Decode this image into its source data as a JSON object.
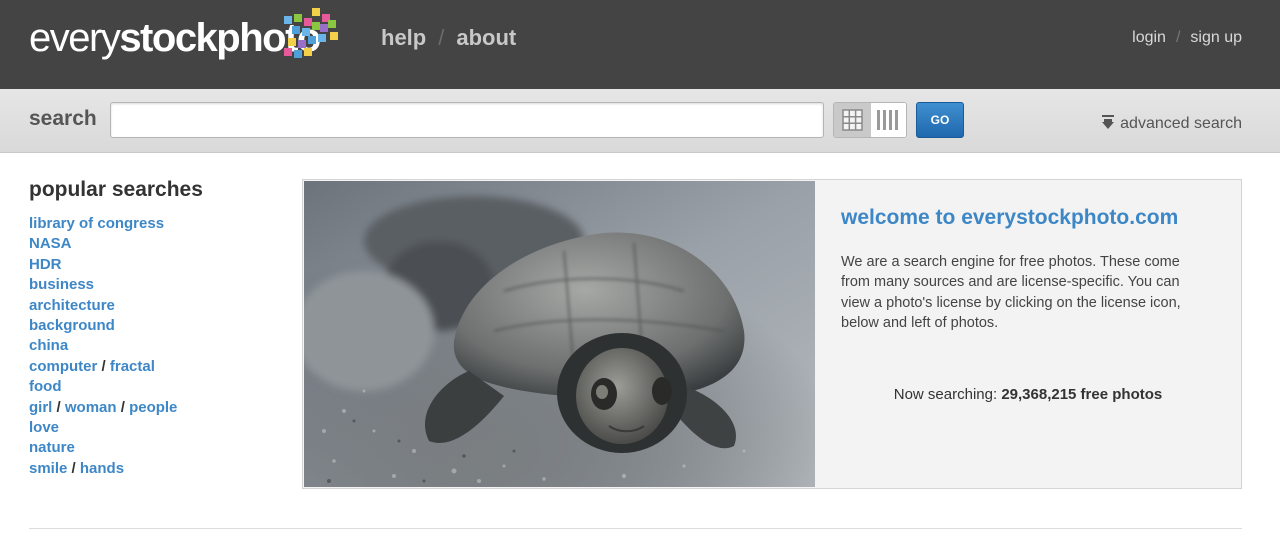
{
  "header": {
    "logo": {
      "light": "every",
      "bold": "stockphoto"
    },
    "nav": [
      {
        "label": "help"
      },
      {
        "label": "about"
      }
    ],
    "nav_separator": "/",
    "user_nav": [
      {
        "label": "login"
      },
      {
        "label": "sign up"
      }
    ],
    "colors": {
      "background": "#444444",
      "logo_squares": [
        "#6ab4e8",
        "#8ac640",
        "#e65a9a",
        "#f2d04a",
        "#9a6fc8",
        "#4fa0d8"
      ]
    }
  },
  "search": {
    "label": "search",
    "query_value": "",
    "view_modes": [
      {
        "name": "grid",
        "active": true
      },
      {
        "name": "columns",
        "active": false
      }
    ],
    "go_label": "GO",
    "advanced_label": "advanced search",
    "icons": {
      "advanced": "download-arrow-icon",
      "grid": "grid-icon",
      "columns": "columns-icon"
    }
  },
  "popular": {
    "title": "popular searches",
    "rows": [
      {
        "items": [
          "library of congress"
        ]
      },
      {
        "items": [
          "NASA"
        ]
      },
      {
        "items": [
          "HDR"
        ]
      },
      {
        "items": [
          "business"
        ]
      },
      {
        "items": [
          "architecture"
        ]
      },
      {
        "items": [
          "background"
        ]
      },
      {
        "items": [
          "china"
        ]
      },
      {
        "items": [
          "computer",
          "fractal"
        ]
      },
      {
        "items": [
          "food"
        ]
      },
      {
        "items": [
          "girl",
          "woman",
          "people"
        ]
      },
      {
        "items": [
          "love"
        ]
      },
      {
        "items": [
          "nature"
        ]
      },
      {
        "items": [
          "smile",
          "hands"
        ]
      }
    ],
    "separator": "/"
  },
  "welcome": {
    "title": "welcome to everystockphoto.com",
    "body": "We are a search engine for free photos. These come from many sources and are license-specific. You can view a photo's license by clicking on the license icon, below and left of photos.",
    "now_searching_label": "Now searching:",
    "now_searching_count": "29,368,215 free photos"
  },
  "colors": {
    "link": "#3e87c7",
    "go_button": "#2574bb"
  }
}
